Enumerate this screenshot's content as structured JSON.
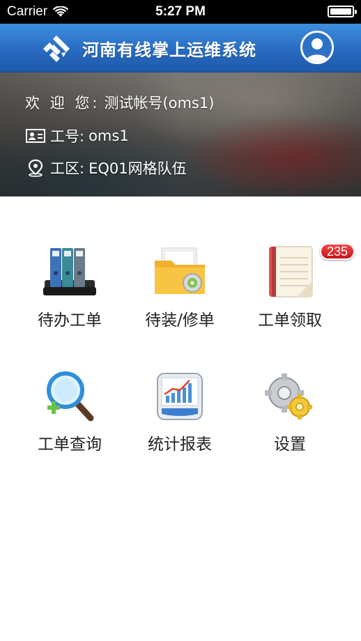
{
  "status_bar": {
    "carrier": "Carrier",
    "time": "5:27 PM"
  },
  "header": {
    "title": "河南有线掌上运维系统",
    "logo_icon": "diamond-logo-icon",
    "avatar_icon": "user-avatar-icon",
    "color": "#2a6cc0"
  },
  "user_info": {
    "welcome_label": "欢 迎 您:",
    "welcome_value": "测试帐号(oms1)",
    "id_label": "工号:",
    "id_value": "oms1",
    "zone_label": "工区:",
    "zone_value": "EQ01网格队伍"
  },
  "menu": {
    "items": [
      {
        "label": "待办工单",
        "icon": "binders-icon"
      },
      {
        "label": "待装/修单",
        "icon": "folder-gear-icon"
      },
      {
        "label": "工单领取",
        "icon": "notebook-icon",
        "badge": "235"
      },
      {
        "label": "工单查询",
        "icon": "magnifier-plus-icon"
      },
      {
        "label": "统计报表",
        "icon": "graph-report-icon"
      },
      {
        "label": "设置",
        "icon": "gears-icon"
      }
    ]
  },
  "colors": {
    "badge": "#d81c22",
    "header_blue": "#2668be"
  }
}
